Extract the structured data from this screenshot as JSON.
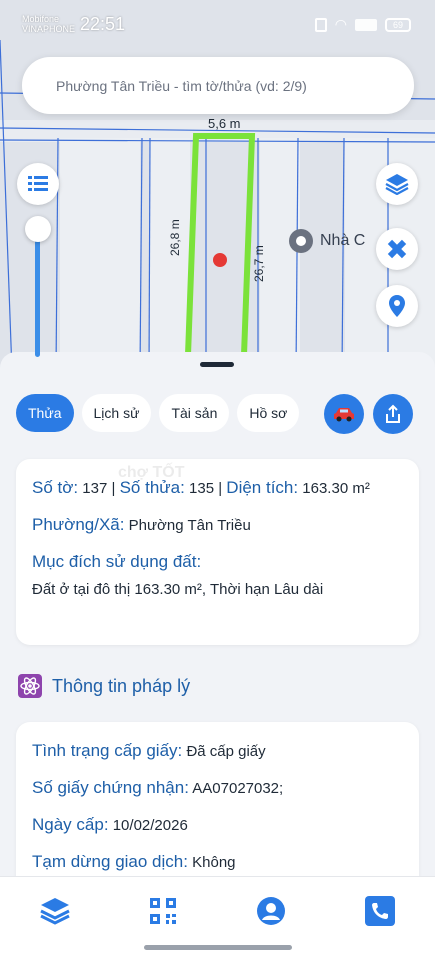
{
  "status": {
    "carrier_line1": "Mobifone",
    "carrier_line2": "VINAPHONE",
    "time": "22:51",
    "battery": "69"
  },
  "search": {
    "placeholder": "Phường Tân Triều - tìm tờ/thửa (vd: 2/9)"
  },
  "map": {
    "width_label": "5,6 m",
    "left_length_label": "26,8 m",
    "right_length_label": "26,7 m",
    "poi_label": "Nhà C",
    "icons": {
      "list": "list-icon",
      "layers": "layers-icon",
      "ruler": "ruler-pencil-icon",
      "location": "location-pin-icon"
    },
    "colors": {
      "parcel_outline": "#7be23a",
      "marker": "#e53935",
      "lines": "#3d6fd8"
    }
  },
  "tabs": [
    {
      "label": "Thửa",
      "active": true
    },
    {
      "label": "Lịch sử",
      "active": false
    },
    {
      "label": "Tài sản",
      "active": false
    },
    {
      "label": "Hồ sơ",
      "active": false
    }
  ],
  "parcel": {
    "so_to_label": "Số tờ:",
    "so_to_value": "137",
    "so_thua_label": "Số thửa:",
    "so_thua_value": "135",
    "dien_tich_label": "Diện tích:",
    "dien_tich_value": "163.30",
    "unit": "m²",
    "separator": "|",
    "ward_label": "Phường/Xã:",
    "ward_value": "Phường Tân Triều",
    "purpose_label": "Mục đích sử dụng đất:",
    "purpose_value": "Đất ở tại đô thị 163.30 m², Thời hạn Lâu dài"
  },
  "legal": {
    "section_title": "Thông tin pháp lý",
    "status_label": "Tình trạng cấp giấy:",
    "status_value": "Đã cấp giấy",
    "cert_label": "Số giấy chứng nhận:",
    "cert_value": "AA07027032;",
    "date_label": "Ngày cấp:",
    "date_value": "10/02/2026",
    "suspend_label": "Tạm dừng giao dịch:",
    "suspend_value": "Không"
  },
  "watermark": "chợ TỐT",
  "theme": {
    "accent": "#2b7be4",
    "label": "#1e5fa8"
  }
}
